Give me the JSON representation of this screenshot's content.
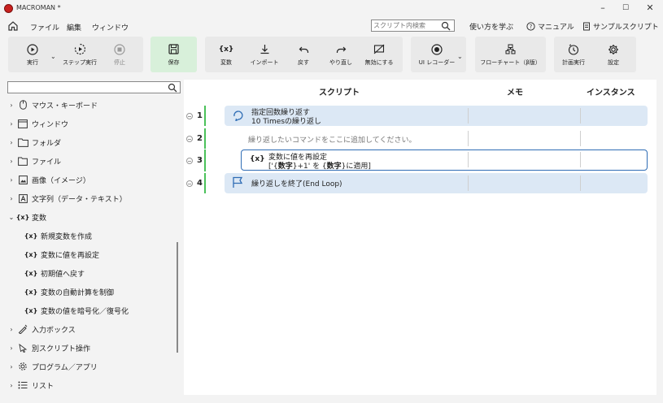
{
  "window": {
    "title": "MACROMAN *",
    "minimize": "–",
    "maximize": "☐",
    "close": "✕"
  },
  "menubar": {
    "items": [
      "ファイル",
      "編集",
      "ウィンドウ"
    ],
    "search_placeholder": "スクリプト内検索",
    "links": [
      "使い方を学ぶ",
      "マニュアル",
      "サンプルスクリプト"
    ]
  },
  "toolbar": {
    "run": "実行",
    "step_run": "ステップ実行",
    "stop": "停止",
    "save": "保存",
    "variable": "変数",
    "import": "インポート",
    "undo": "戻す",
    "redo": "やり直し",
    "disable": "無効にする",
    "ui_recorder": "UI レコーダー",
    "flowchart": "フローチャート（β版）",
    "schedule": "計画実行",
    "settings": "設定"
  },
  "sidebar": {
    "search_value": "",
    "items": [
      {
        "label": "マウス・キーボード",
        "expanded": false,
        "icon": "mouse-icon"
      },
      {
        "label": "ウィンドウ",
        "expanded": false,
        "icon": "window-icon"
      },
      {
        "label": "フォルダ",
        "expanded": false,
        "icon": "folder-icon"
      },
      {
        "label": "ファイル",
        "expanded": false,
        "icon": "file-icon"
      },
      {
        "label": "画像（イメージ）",
        "expanded": false,
        "icon": "image-icon"
      },
      {
        "label": "文字列（データ・テキスト）",
        "expanded": false,
        "icon": "text-icon"
      },
      {
        "label": "変数",
        "expanded": true,
        "icon": "variable-icon"
      },
      {
        "label": "新規変数を作成",
        "child": true,
        "icon": "variable-icon"
      },
      {
        "label": "変数に値を再設定",
        "child": true,
        "icon": "variable-icon"
      },
      {
        "label": "初期値へ戻す",
        "child": true,
        "icon": "variable-icon"
      },
      {
        "label": "変数の自動計算を制御",
        "child": true,
        "icon": "variable-icon"
      },
      {
        "label": "変数の値を暗号化／復号化",
        "child": true,
        "icon": "variable-icon"
      },
      {
        "label": "入力ボックス",
        "expanded": false,
        "icon": "input-box-icon"
      },
      {
        "label": "別スクリプト操作",
        "expanded": false,
        "icon": "script-icon"
      },
      {
        "label": "プログラム／アプリ",
        "expanded": false,
        "icon": "program-icon"
      },
      {
        "label": "リスト",
        "expanded": false,
        "icon": "list-icon"
      }
    ],
    "variable_glyph": "{x}"
  },
  "script": {
    "columns": [
      "スクリプト",
      "メモ",
      "インスタンス"
    ],
    "rows": [
      {
        "num": "1",
        "title": "指定回数繰り返す",
        "detail": "10 Timesの繰り返し"
      },
      {
        "num": "2",
        "placeholder": "繰り返したいコマンドをここに追加してください。"
      },
      {
        "num": "3",
        "icon_text": "{x}",
        "title": "変数に値を再設定",
        "detail_pre": "['{",
        "detail_b1": "数字",
        "detail_mid": "}+1' を {",
        "detail_b2": "数字",
        "detail_post": "}に適用]"
      },
      {
        "num": "4",
        "title": "繰り返しを終了(End Loop)"
      }
    ]
  },
  "colors": {
    "accent_blue": "#2f6db5",
    "loop_bg": "#dce8f5",
    "line_green": "#4bc15a",
    "save_bg": "#d8f0da"
  }
}
